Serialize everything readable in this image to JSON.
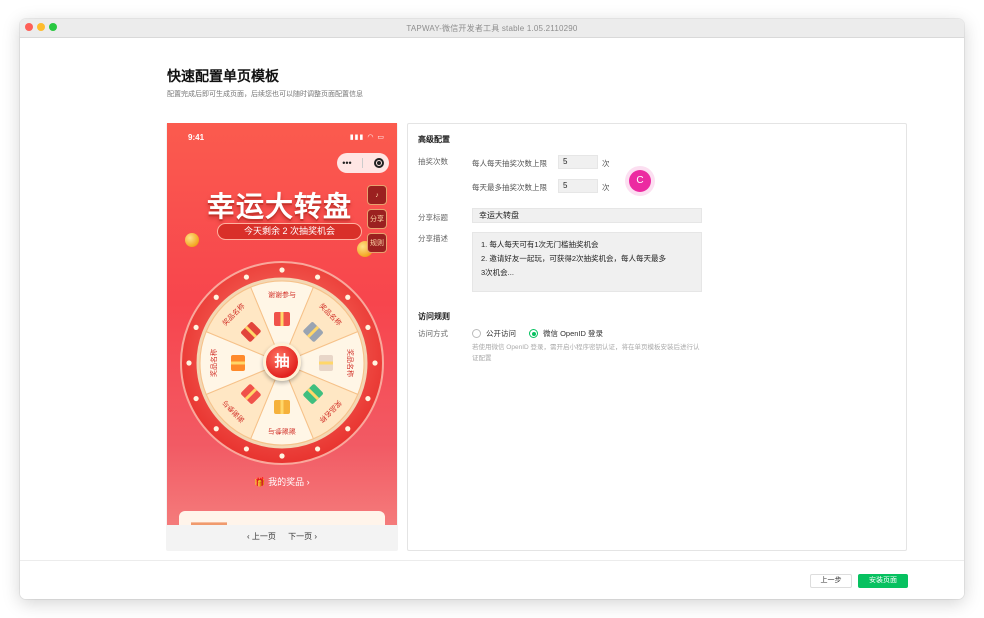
{
  "window": {
    "title": "TAPWAY-微信开发者工具 stable 1.05.2110290"
  },
  "page": {
    "title": "快速配置单页模板",
    "subtitle": "配置完成后即可生成页面，后续您也可以随时调整页面配置信息"
  },
  "preview": {
    "status_time": "9:41",
    "capsule_more": "•••",
    "side_buttons": [
      "♪",
      "分享",
      "规则"
    ],
    "headline": "幸运大转盘",
    "chance_text": "今天剩余 2 次抽奖机会",
    "draw_button": "抽",
    "wheel_labels": [
      "谢谢参与",
      "奖品名称",
      "奖品名称",
      "奖品名称",
      "谢谢参与",
      "谢谢参与",
      "奖品名称",
      "奖品名称"
    ],
    "my_prize": "🎁 我的奖品  ›",
    "pager_prev": "‹ 上一页",
    "pager_next": "下一页 ›"
  },
  "config": {
    "advanced_title": "高级配置",
    "draw_times_label": "抽奖次数",
    "daily_limit_label": "每人每天抽奖次数上限",
    "daily_limit_value": "5",
    "daily_limit_unit": "次",
    "max_limit_label": "每天最多抽奖次数上限",
    "max_limit_value": "5",
    "max_limit_unit": "次",
    "share_title_label": "分享标题",
    "share_title_value": "幸运大转盘",
    "share_desc_label": "分享描述",
    "share_desc_lines": [
      "1. 每人每天可有1次无门槛抽奖机会",
      "2. 邀请好友一起玩，可获得2次抽奖机会，每人每天最多",
      "    3次机会..."
    ],
    "cursor_badge": "C",
    "access_title": "访问规则",
    "access_label": "访问方式",
    "access_options": [
      "公开访问",
      "微信 OpenID 登录"
    ],
    "access_selected": "微信 OpenID 登录",
    "access_hint": "若使用微信 OpenID 登录，需开启小程序密钥认证，将在单页模板安装后进行认证配置"
  },
  "footer": {
    "prev_button": "上一步",
    "install_button": "安装页面"
  },
  "colors": {
    "accent": "#07c160",
    "cursor": "#ec2ba1",
    "phone_red": "#f7454d"
  }
}
